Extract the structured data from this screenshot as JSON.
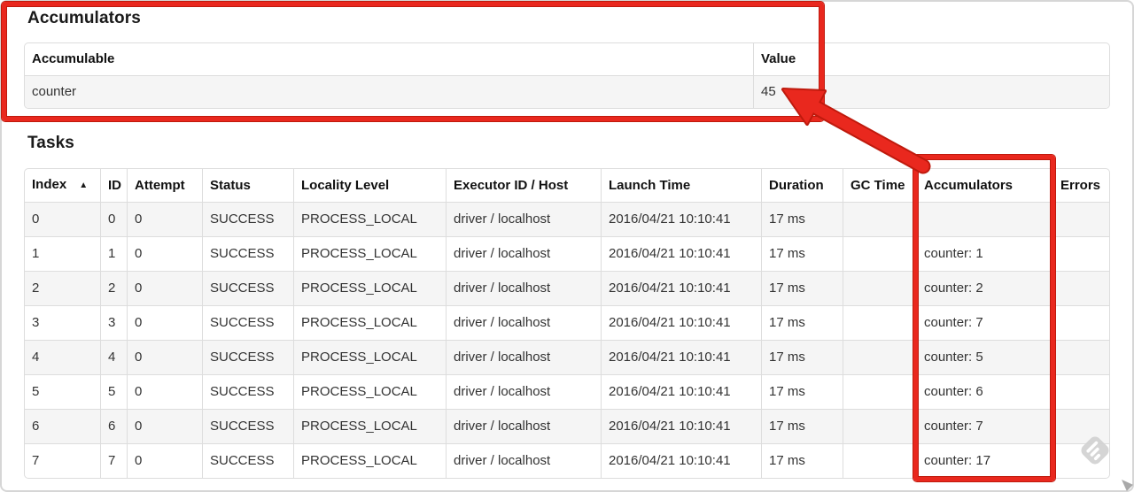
{
  "colors": {
    "annotation_red": "#e9281e",
    "annotation_red_dark": "#bf1a0d",
    "table_border": "#dddddd",
    "stripe_background": "#f5f5f5",
    "text": "#333333",
    "watermark_gray": "#d3d3d3"
  },
  "accumulators_section": {
    "title": "Accumulators",
    "headers": [
      "Accumulable",
      "Value"
    ],
    "rows": [
      {
        "accumulable": "counter",
        "value": "45"
      }
    ]
  },
  "tasks_section": {
    "title": "Tasks",
    "sort_indicator": "▲",
    "headers": [
      "Index",
      "ID",
      "Attempt",
      "Status",
      "Locality Level",
      "Executor ID / Host",
      "Launch Time",
      "Duration",
      "GC Time",
      "Accumulators",
      "Errors"
    ],
    "rows": [
      {
        "index": "0",
        "id": "0",
        "attempt": "0",
        "status": "SUCCESS",
        "locality_level": "PROCESS_LOCAL",
        "executor_id_host": "driver / localhost",
        "launch_time": "2016/04/21 10:10:41",
        "duration": "17 ms",
        "gc_time": "",
        "accumulators": "",
        "errors": ""
      },
      {
        "index": "1",
        "id": "1",
        "attempt": "0",
        "status": "SUCCESS",
        "locality_level": "PROCESS_LOCAL",
        "executor_id_host": "driver / localhost",
        "launch_time": "2016/04/21 10:10:41",
        "duration": "17 ms",
        "gc_time": "",
        "accumulators": "counter: 1",
        "errors": ""
      },
      {
        "index": "2",
        "id": "2",
        "attempt": "0",
        "status": "SUCCESS",
        "locality_level": "PROCESS_LOCAL",
        "executor_id_host": "driver / localhost",
        "launch_time": "2016/04/21 10:10:41",
        "duration": "17 ms",
        "gc_time": "",
        "accumulators": "counter: 2",
        "errors": ""
      },
      {
        "index": "3",
        "id": "3",
        "attempt": "0",
        "status": "SUCCESS",
        "locality_level": "PROCESS_LOCAL",
        "executor_id_host": "driver / localhost",
        "launch_time": "2016/04/21 10:10:41",
        "duration": "17 ms",
        "gc_time": "",
        "accumulators": "counter: 7",
        "errors": ""
      },
      {
        "index": "4",
        "id": "4",
        "attempt": "0",
        "status": "SUCCESS",
        "locality_level": "PROCESS_LOCAL",
        "executor_id_host": "driver / localhost",
        "launch_time": "2016/04/21 10:10:41",
        "duration": "17 ms",
        "gc_time": "",
        "accumulators": "counter: 5",
        "errors": ""
      },
      {
        "index": "5",
        "id": "5",
        "attempt": "0",
        "status": "SUCCESS",
        "locality_level": "PROCESS_LOCAL",
        "executor_id_host": "driver / localhost",
        "launch_time": "2016/04/21 10:10:41",
        "duration": "17 ms",
        "gc_time": "",
        "accumulators": "counter: 6",
        "errors": ""
      },
      {
        "index": "6",
        "id": "6",
        "attempt": "0",
        "status": "SUCCESS",
        "locality_level": "PROCESS_LOCAL",
        "executor_id_host": "driver / localhost",
        "launch_time": "2016/04/21 10:10:41",
        "duration": "17 ms",
        "gc_time": "",
        "accumulators": "counter: 7",
        "errors": ""
      },
      {
        "index": "7",
        "id": "7",
        "attempt": "0",
        "status": "SUCCESS",
        "locality_level": "PROCESS_LOCAL",
        "executor_id_host": "driver / localhost",
        "launch_time": "2016/04/21 10:10:41",
        "duration": "17 ms",
        "gc_time": "",
        "accumulators": "counter: 17",
        "errors": ""
      }
    ]
  }
}
